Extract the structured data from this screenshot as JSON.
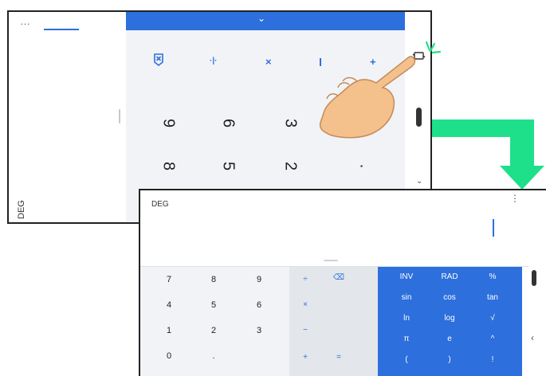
{
  "phone_before": {
    "more_label": "…",
    "expand_chevron": "⌄",
    "deg_label": "DEG",
    "ops_row": [
      "⌫",
      "·|·",
      "×",
      "–",
      "+"
    ],
    "key_rows": [
      [
        "9",
        "6",
        "3",
        ""
      ],
      [
        "8",
        "5",
        "2",
        "."
      ]
    ],
    "rotate_icon": "⭯",
    "scroll_chevron": "⌄"
  },
  "phone_after": {
    "deg_label": "DEG",
    "more_label": "⋮",
    "digits": [
      [
        "7",
        "8",
        "9"
      ],
      [
        "4",
        "5",
        "6"
      ],
      [
        "1",
        "2",
        "3"
      ],
      [
        "0",
        ".",
        ""
      ]
    ],
    "ops": [
      [
        "÷",
        "⌫"
      ],
      [
        "×",
        ""
      ],
      [
        "−",
        ""
      ],
      [
        "+",
        "="
      ]
    ],
    "sci": [
      [
        "INV",
        "RAD",
        "%"
      ],
      [
        "sin",
        "cos",
        "tan"
      ],
      [
        "ln",
        "log",
        "√"
      ],
      [
        "π",
        "e",
        "^"
      ],
      [
        "(",
        ")",
        "!"
      ]
    ],
    "side_chevron": "‹"
  },
  "colors": {
    "accent": "#2d6fdc",
    "arrow_green": "#1fe08a",
    "hand_skin": "#f4c08c"
  }
}
